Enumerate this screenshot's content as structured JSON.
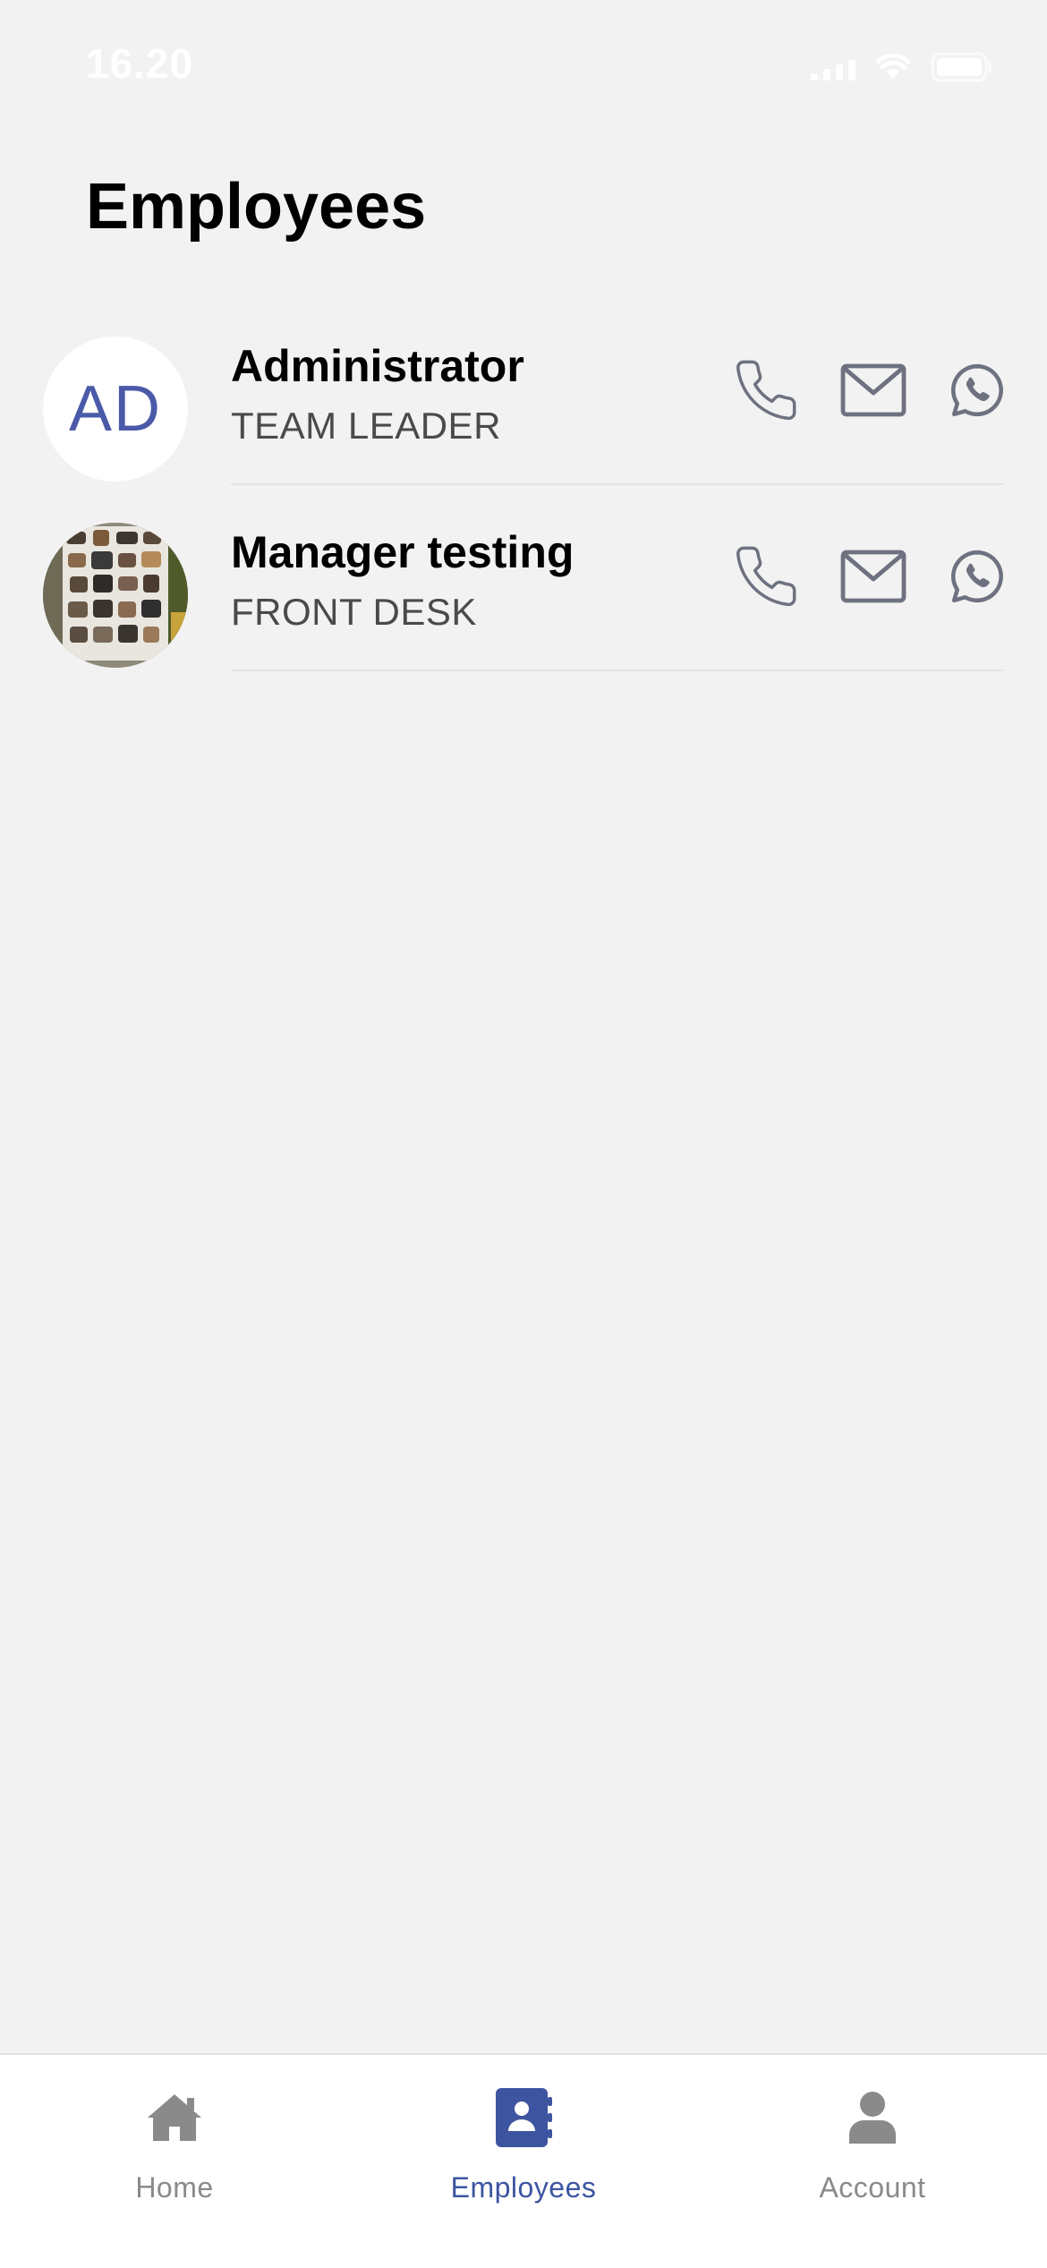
{
  "status_bar": {
    "time": "16.20",
    "icons": [
      "signal-icon",
      "wifi-icon",
      "battery-icon"
    ]
  },
  "page": {
    "title": "Employees"
  },
  "employees": [
    {
      "name": "Administrator",
      "role": "TEAM LEADER",
      "avatar_type": "initials",
      "initials": "AD",
      "actions": [
        "phone-icon",
        "mail-icon",
        "whatsapp-icon"
      ]
    },
    {
      "name": "Manager testing",
      "role": "FRONT DESK",
      "avatar_type": "photo",
      "actions": [
        "phone-icon",
        "mail-icon",
        "whatsapp-icon"
      ]
    }
  ],
  "tab_bar": {
    "tabs": [
      {
        "label": "Home",
        "icon": "home-icon",
        "active": false
      },
      {
        "label": "Employees",
        "icon": "contacts-book-icon",
        "active": true
      },
      {
        "label": "Account",
        "icon": "person-icon",
        "active": false
      }
    ]
  },
  "colors": {
    "background": "#f2f2f2",
    "accent": "#3d55a0",
    "action_icon": "#6e7180",
    "tab_inactive": "#8a8a8a",
    "initials_text": "#4a5aa8"
  }
}
